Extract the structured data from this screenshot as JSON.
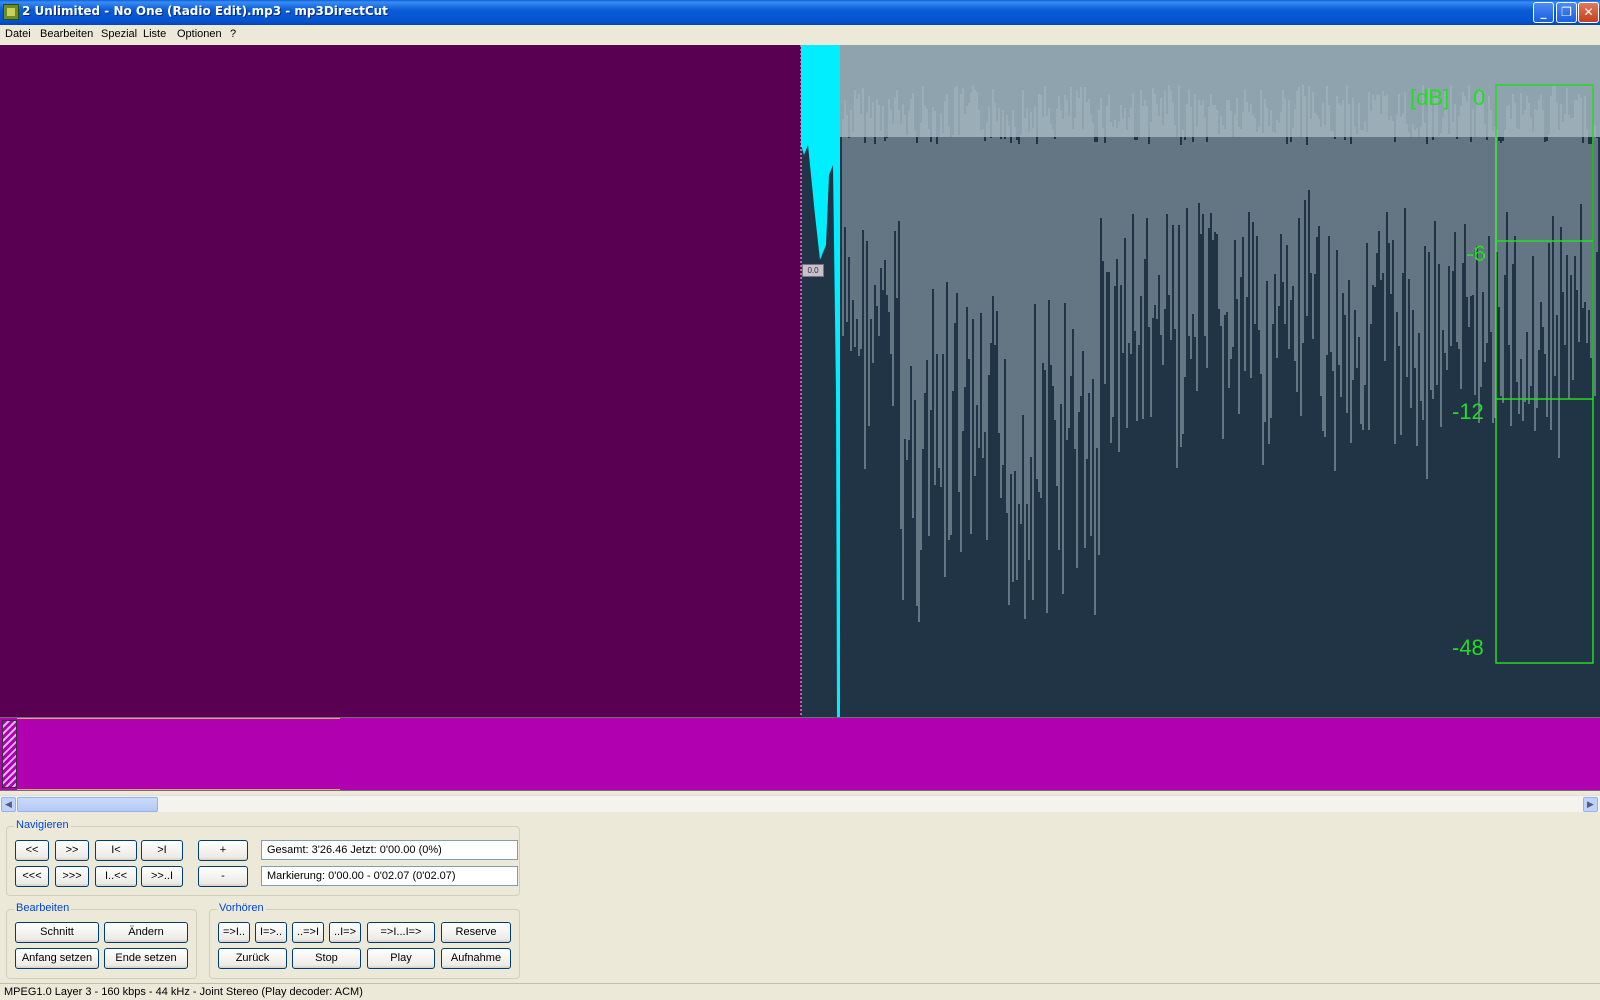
{
  "window": {
    "title": "2 Unlimited - No One (Radio Edit).mp3 - mp3DirectCut",
    "minimize": "_",
    "restore": "❐",
    "close": "✕"
  },
  "menu": [
    "Datei",
    "Bearbeiten",
    "Spezial",
    "Liste",
    "Optionen",
    "?"
  ],
  "waveform": {
    "db_unit": "[dB]",
    "db_zero": "0",
    "db_labels": [
      "-6",
      "-12",
      "-48"
    ],
    "position_tag": "0.0",
    "colors": {
      "selection": "#5a0052",
      "background": "#203446",
      "peak_area": "#8ea3ad",
      "cursor_block": "#00eeff",
      "meter": "#22dd22"
    }
  },
  "overview": {
    "color": "#b000b0",
    "position_fraction": 0
  },
  "navigate": {
    "title": "Navigieren",
    "buttons_row1": [
      "<<",
      ">>",
      "I<",
      ">I"
    ],
    "buttons_row2": [
      "<<<",
      ">>>",
      "I..<<",
      ">>..I"
    ],
    "plus": "+",
    "minus": "-",
    "total": "Gesamt: 3'26.46   Jetzt: 0'00.00   (0%)",
    "marking": "Markierung: 0'00.00 - 0'02.07 (0'02.07)"
  },
  "edit": {
    "title": "Bearbeiten",
    "cut": "Schnitt",
    "change": "Ändern",
    "set_start": "Anfang setzen",
    "set_end": "Ende setzen"
  },
  "preview": {
    "title": "Vorhören",
    "row1": [
      "=>I..",
      "I=>..",
      "..=>I",
      "..I=>",
      "=>I...I=>",
      "Reserve"
    ],
    "row2": [
      "Zurück",
      "Stop",
      "Play",
      "Aufnahme"
    ]
  },
  "status": "MPEG1.0 Layer 3 - 160 kbps - 44 kHz - Joint Stereo   (Play decoder: ACM)"
}
